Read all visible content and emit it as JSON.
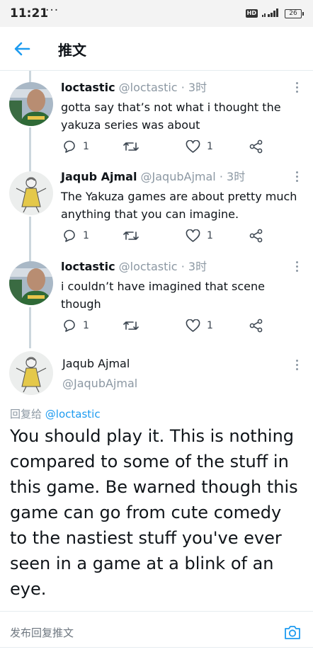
{
  "status_bar": {
    "time": "11:21",
    "dots": "···",
    "hd": "HD",
    "signal": "4G",
    "battery": "26"
  },
  "header": {
    "title": "推文"
  },
  "tweets": [
    {
      "name": "loctastic",
      "handle": "@loctastic",
      "sep": "·",
      "time": "3时",
      "text": "gotta say that’s not what i thought the yakuza series was about",
      "reply_count": "1",
      "like_count": "1"
    },
    {
      "name": "Jaqub Ajmal",
      "handle": "@JaqubAjmal",
      "sep": "·",
      "time": "3时",
      "text": "The Yakuza games are about pretty much anything that you can imagine.",
      "reply_count": "1",
      "like_count": "1"
    },
    {
      "name": "loctastic",
      "handle": "@loctastic",
      "sep": "·",
      "time": "3时",
      "text": "i couldn’t have imagined that scene though",
      "reply_count": "1",
      "like_count": "1"
    }
  ],
  "main_tweet": {
    "name": "Jaqub Ajmal",
    "handle": "@JaqubAjmal",
    "reply_prefix": "回复给",
    "reply_mention": "@loctastic",
    "text": "You should play it. This is nothing compared to some of the stuff in this game. Be warned though this game can go from cute comedy to the nastiest stuff you've ever seen in a game at a blink of an eye."
  },
  "reply_bar": {
    "placeholder": "发布回复推文"
  },
  "colors": {
    "accent": "#1d9bf0",
    "thread_line": "#ccd6dd",
    "muted_text": "#8c98a3"
  }
}
